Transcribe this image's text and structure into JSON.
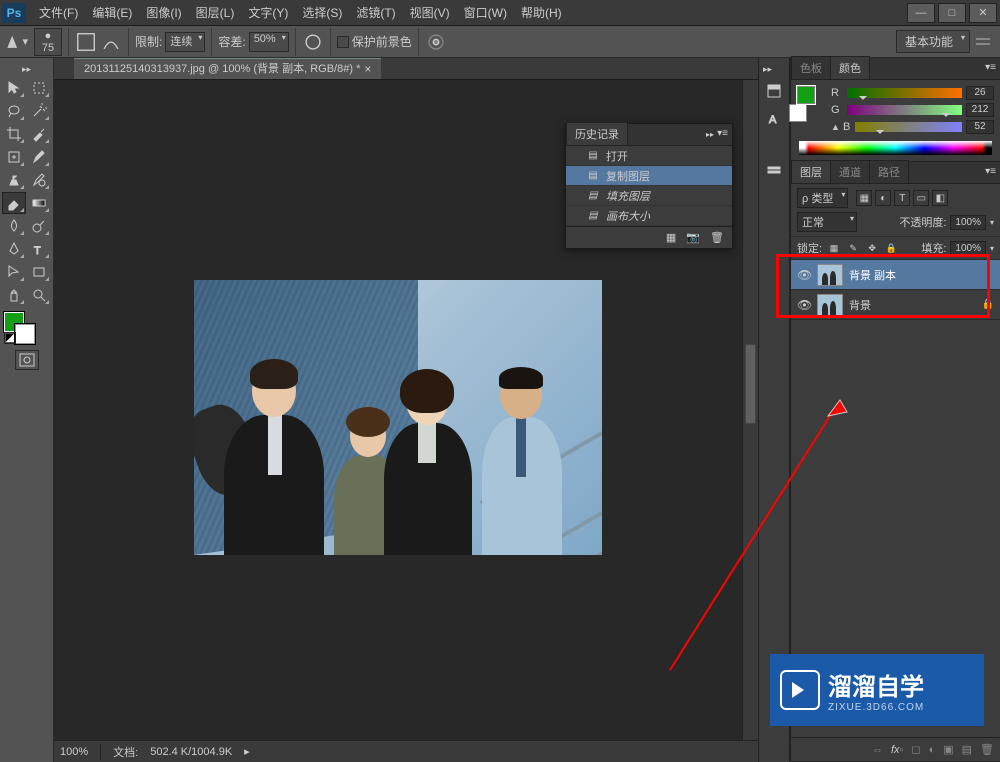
{
  "app": {
    "logo": "Ps"
  },
  "menu": {
    "file": "文件(F)",
    "edit": "编辑(E)",
    "image": "图像(I)",
    "layer": "图层(L)",
    "type": "文字(Y)",
    "select": "选择(S)",
    "filter": "滤镜(T)",
    "view": "视图(V)",
    "window": "窗口(W)",
    "help": "帮助(H)"
  },
  "win": {
    "min": "—",
    "max": "□",
    "close": "✕"
  },
  "options": {
    "brush_size": "75",
    "limit_label": "限制:",
    "limit_value": "连续",
    "tolerance_label": "容差:",
    "tolerance_value": "50%",
    "protect_fg": "保护前景色",
    "workspace": "基本功能"
  },
  "document": {
    "tab_title": "20131125140313937.jpg @ 100% (背景 副本, RGB/8#) *",
    "zoom": "100%",
    "doc_info_label": "文档:",
    "doc_info": "502.4 K/1004.9K"
  },
  "history": {
    "title": "历史记录",
    "items": [
      {
        "label": "打开",
        "selected": false,
        "disabled": false
      },
      {
        "label": "复制图层",
        "selected": true,
        "disabled": false
      },
      {
        "label": "填充图层",
        "selected": false,
        "disabled": true
      },
      {
        "label": "画布大小",
        "selected": false,
        "disabled": true
      }
    ]
  },
  "color_panel": {
    "tab1": "色板",
    "tab2": "颜色",
    "r": "26",
    "g": "212",
    "b": "52",
    "r_label": "R",
    "g_label": "G",
    "b_label": "B"
  },
  "layers_panel": {
    "tab1": "图层",
    "tab2": "通道",
    "tab3": "路径",
    "kind_label": "ρ 类型",
    "blend_mode": "正常",
    "opacity_label": "不透明度:",
    "opacity_value": "100%",
    "lock_label": "锁定:",
    "fill_label": "填充:",
    "fill_value": "100%",
    "layers": [
      {
        "name": "背景 副本",
        "selected": true,
        "locked": false
      },
      {
        "name": "背景",
        "selected": false,
        "locked": true
      }
    ]
  },
  "watermark": {
    "main": "溜溜自学",
    "sub": "ZIXUE.3D66.COM"
  }
}
